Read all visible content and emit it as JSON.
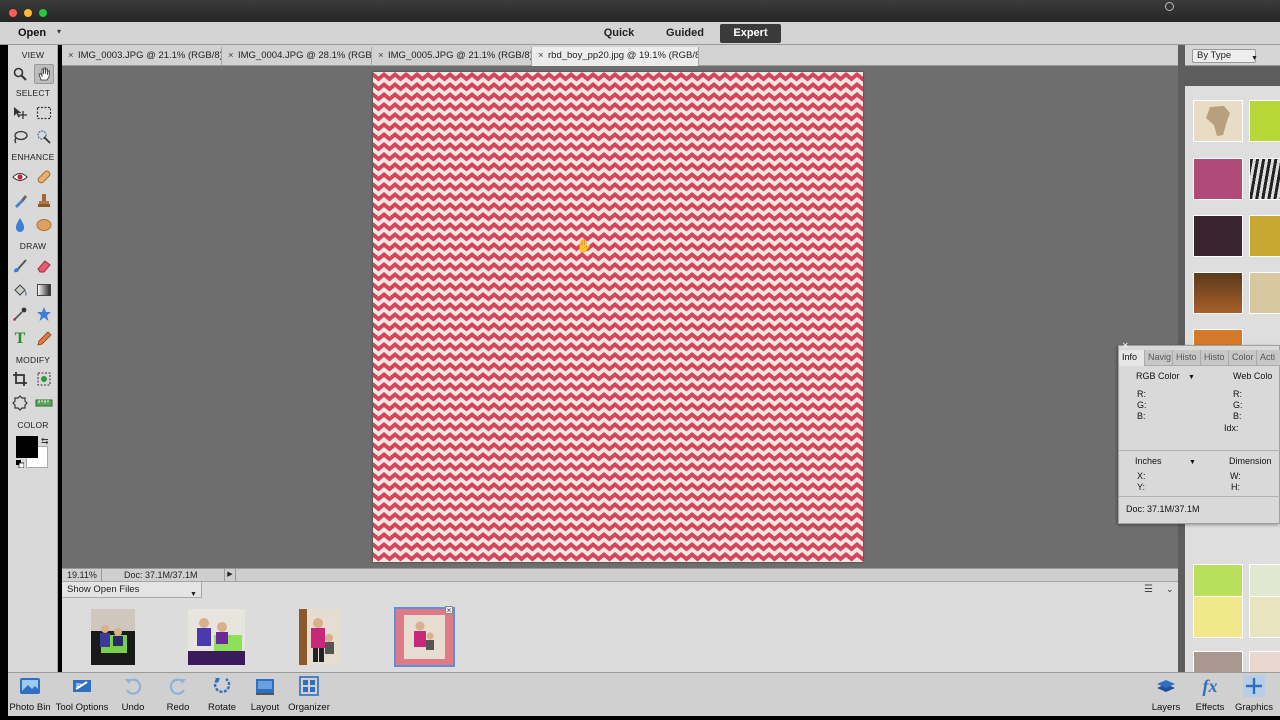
{
  "app": {
    "open_label": "Open",
    "modes": [
      "Quick",
      "Guided",
      "Expert"
    ],
    "active_mode": "Expert"
  },
  "toolbox": {
    "sections": {
      "view": "VIEW",
      "select": "SELECT",
      "enhance": "ENHANCE",
      "draw": "DRAW",
      "modify": "MODIFY",
      "color": "COLOR"
    },
    "foreground_color": "#000000",
    "background_color": "#ffffff"
  },
  "tabs": [
    {
      "label": "IMG_0003.JPG @ 21.1% (RGB/8) *"
    },
    {
      "label": "IMG_0004.JPG @ 28.1% (RGB/8) *"
    },
    {
      "label": "IMG_0005.JPG @ 21.1% (RGB/8) *"
    },
    {
      "label": "rbd_boy_pp20.jpg @ 19.1% (RGB/8)"
    }
  ],
  "canvas": {
    "pattern_color": "#d44559",
    "paper_color": "#f4e6e3"
  },
  "status": {
    "zoom": "19.11%",
    "doc": "Doc: 37.1M/37.1M"
  },
  "photo_bin": {
    "show_label": "Show Open Files"
  },
  "right_panel": {
    "filter_label": "By Type"
  },
  "info_panel": {
    "tabs": [
      "Info",
      "Navig",
      "Histo",
      "Histo",
      "Color",
      "Acti"
    ],
    "rgb_mode": "RGB Color",
    "web_mode": "Web Colo",
    "r": "R:",
    "g": "G:",
    "b": "B:",
    "idx": "Idx:",
    "units": "Inches",
    "dimension": "Dimension",
    "x": "X:",
    "y": "Y:",
    "w": "W:",
    "h": "H:",
    "doc": "Doc: 37.1M/37.1M"
  },
  "taskbar": {
    "photo_bin": "Photo Bin",
    "tool_options": "Tool Options",
    "undo": "Undo",
    "redo": "Redo",
    "rotate": "Rotate",
    "layout": "Layout",
    "organizer": "Organizer",
    "layers": "Layers",
    "effects": "Effects",
    "graphics": "Graphics"
  }
}
